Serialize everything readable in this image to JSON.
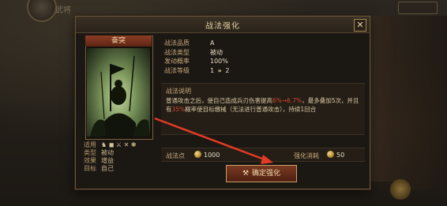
{
  "dialog": {
    "title": "战法强化",
    "close_label": "✕"
  },
  "card": {
    "name": "奋突"
  },
  "info": {
    "rows": [
      {
        "k": "战法品质",
        "v": "A"
      },
      {
        "k": "战法类型",
        "v": "被动"
      },
      {
        "k": "发动概率",
        "v": "100%"
      }
    ],
    "level_label": "战法等级",
    "level_from": "1",
    "level_to": "2"
  },
  "description": {
    "title": "战法说明",
    "text_1": "普通攻击之后，使自己造成兵刃伤害提高",
    "highlight_1": "6%→6.7%",
    "text_2": "，最多叠加5次，并且有",
    "highlight_2": "35%",
    "text_3": "概率使目标缴械（无法进行普通攻击），持续1回合"
  },
  "stats": {
    "rows": [
      {
        "k": "适用",
        "v": "♞ ◼ ⚔ ✕ ❃"
      },
      {
        "k": "类型",
        "v": "被动"
      },
      {
        "k": "效果",
        "v": "增益"
      },
      {
        "k": "目标",
        "v": "自己"
      }
    ]
  },
  "cost": {
    "left_label": "战法点",
    "left_value": "1000",
    "right_label": "强化消耗",
    "right_value": "50"
  },
  "confirm": {
    "label": "确定强化"
  },
  "background": {
    "player_name": "武将"
  },
  "colors": {
    "accent_gold": "#c6a066",
    "highlight_red": "#d4482e",
    "button_red": "#7a3a22"
  }
}
